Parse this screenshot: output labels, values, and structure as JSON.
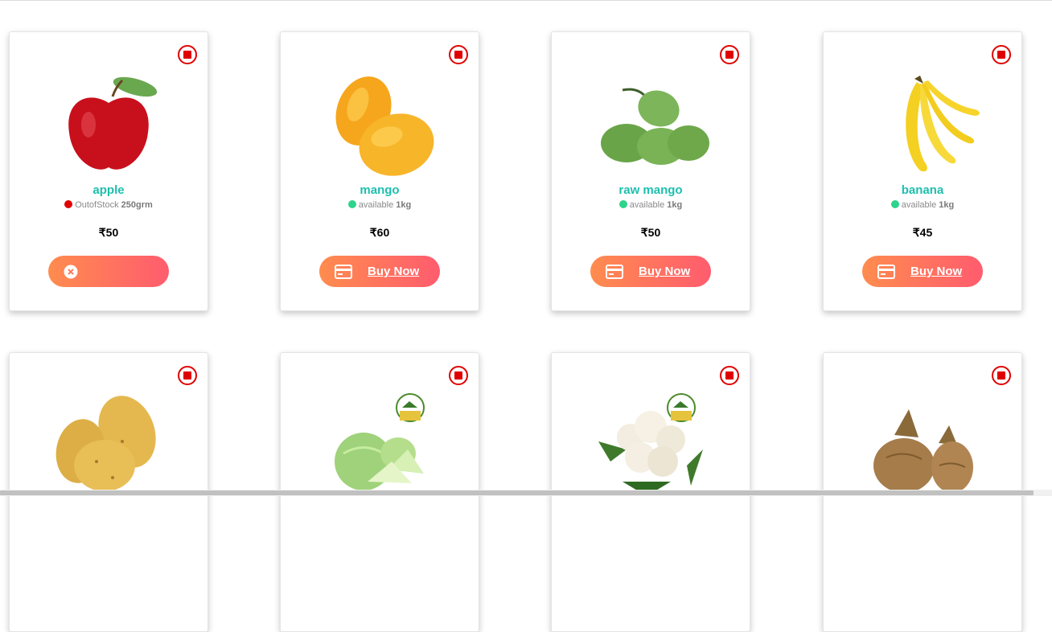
{
  "products": [
    {
      "name": "apple",
      "status": "OutofStock",
      "status_color": "#e00000",
      "qty": "250grm",
      "price": "₹50",
      "button_label": "",
      "out_of_stock": true,
      "icon": "apple-image"
    },
    {
      "name": "mango",
      "status": "available",
      "status_color": "#2ed38c",
      "qty": "1kg",
      "price": "₹60",
      "button_label": "Buy Now",
      "out_of_stock": false,
      "icon": "mango-image"
    },
    {
      "name": "raw mango",
      "status": "available",
      "status_color": "#2ed38c",
      "qty": "1kg",
      "price": "₹50",
      "button_label": "Buy Now",
      "out_of_stock": false,
      "icon": "raw-mango-image"
    },
    {
      "name": "banana",
      "status": "available",
      "status_color": "#2ed38c",
      "qty": "1kg",
      "price": "₹45",
      "button_label": "Buy Now",
      "out_of_stock": false,
      "icon": "banana-image"
    },
    {
      "name": "",
      "status": "",
      "qty": "",
      "price": "",
      "button_label": "",
      "icon": "potato-image"
    },
    {
      "name": "",
      "status": "",
      "qty": "",
      "price": "",
      "button_label": "",
      "icon": "cabbage-image"
    },
    {
      "name": "",
      "status": "",
      "qty": "",
      "price": "",
      "button_label": "",
      "icon": "cauliflower-image"
    },
    {
      "name": "",
      "status": "",
      "qty": "",
      "price": "",
      "button_label": "",
      "icon": "coconut-image"
    }
  ],
  "colors": {
    "accent_text": "#1dbfae",
    "button_start": "#ff8c4f",
    "button_end": "#ff5c6e",
    "veg_mark": "#e00000"
  }
}
